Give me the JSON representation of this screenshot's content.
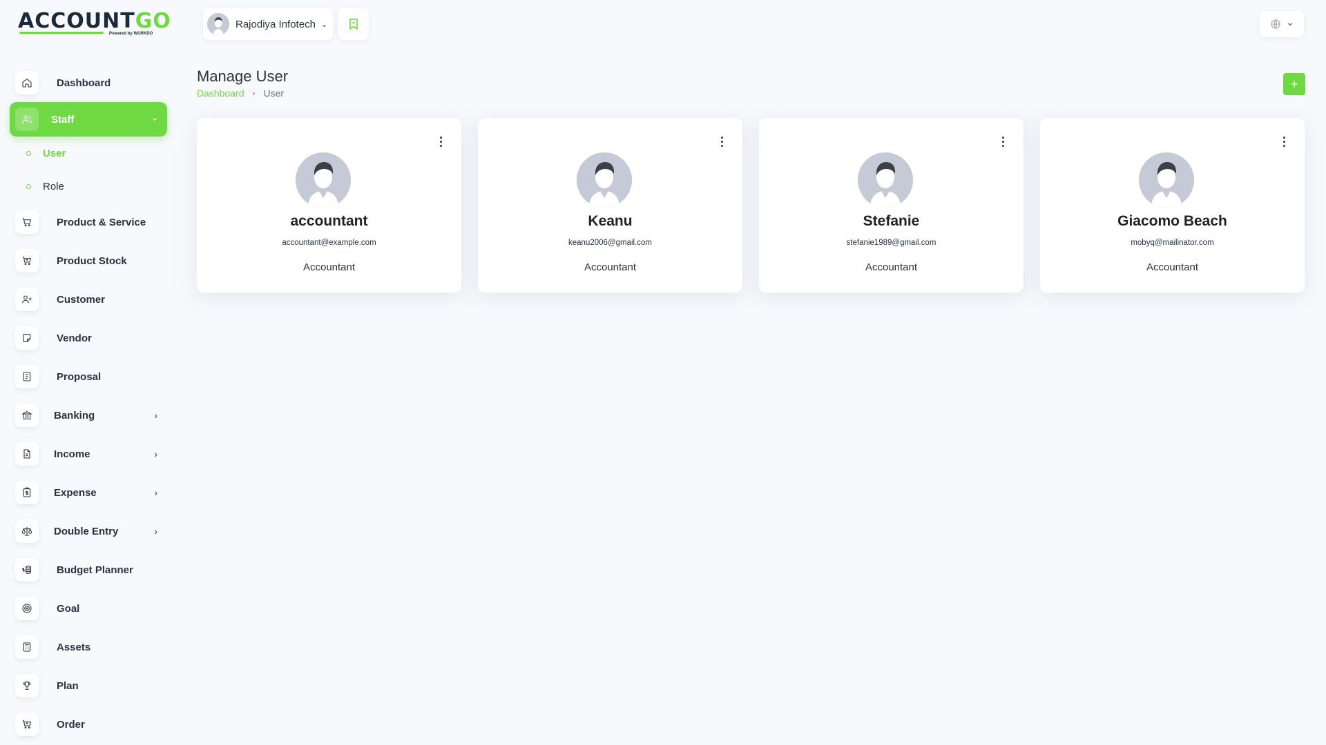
{
  "brand": {
    "logo_main": "ACCOUNT",
    "logo_accent": "GO",
    "logo_sub": "Powered by WORKDO"
  },
  "colors": {
    "accent": "#6fd943",
    "text": "#293240",
    "background": "#f8f9fd"
  },
  "sidebar": {
    "items": [
      {
        "label": "Dashboard",
        "icon": "home-icon"
      },
      {
        "label": "Staff",
        "icon": "users-icon",
        "active": true
      },
      {
        "label": "Product & Service",
        "icon": "cart-icon"
      },
      {
        "label": "Product Stock",
        "icon": "cart-plus-icon"
      },
      {
        "label": "Customer",
        "icon": "user-plus-icon"
      },
      {
        "label": "Vendor",
        "icon": "note-icon"
      },
      {
        "label": "Proposal",
        "icon": "receipt-icon"
      },
      {
        "label": "Banking",
        "icon": "bank-icon"
      },
      {
        "label": "Income",
        "icon": "file-icon"
      },
      {
        "label": "Expense",
        "icon": "clipboard-dollar-icon"
      },
      {
        "label": "Double Entry",
        "icon": "scale-icon"
      },
      {
        "label": "Budget Planner",
        "icon": "coins-icon"
      },
      {
        "label": "Goal",
        "icon": "target-icon"
      },
      {
        "label": "Assets",
        "icon": "calculator-icon"
      },
      {
        "label": "Plan",
        "icon": "trophy-icon"
      },
      {
        "label": "Order",
        "icon": "cart-plus-icon"
      }
    ],
    "staff_sub": [
      {
        "label": "User"
      },
      {
        "label": "Role"
      }
    ]
  },
  "header": {
    "company": "Rajodiya Infotech",
    "language_icon": "globe-icon",
    "bookmark_icon": "bookmark-icon"
  },
  "page": {
    "title": "Manage User",
    "breadcrumb": [
      "Dashboard",
      "User"
    ],
    "add_label": "+"
  },
  "users": [
    {
      "name": "accountant",
      "email": "accountant@example.com",
      "role": "Accountant"
    },
    {
      "name": "Keanu",
      "email": "keanu2006@gmail.com",
      "role": "Accountant"
    },
    {
      "name": "Stefanie",
      "email": "stefanie1989@gmail.com",
      "role": "Accountant"
    },
    {
      "name": "Giacomo Beach",
      "email": "mobyq@mailinator.com",
      "role": "Accountant"
    }
  ]
}
